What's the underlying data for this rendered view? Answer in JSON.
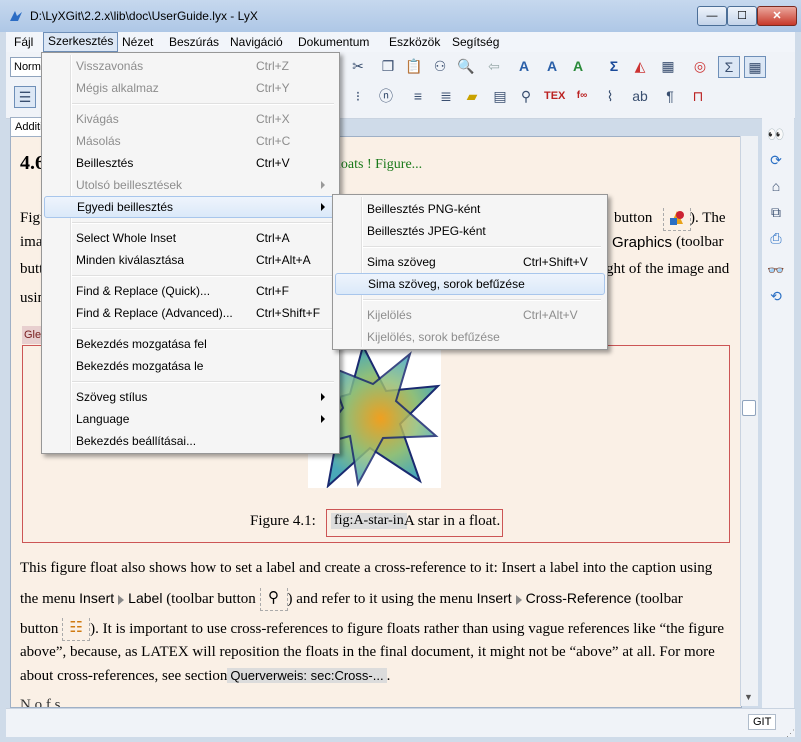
{
  "window": {
    "title": "D:\\LyXGit\\2.2.x\\lib\\doc\\UserGuide.lyx - LyX",
    "minimize_glyph": "—",
    "maximize_glyph": "☐",
    "close_glyph": "✕"
  },
  "menubar": {
    "items": [
      "Fájl",
      "Szerkesztés",
      "Nézet",
      "Beszúrás",
      "Navigáció",
      "Dokumentum",
      "Eszközök",
      "Segítség"
    ],
    "active": "Szerkesztés"
  },
  "toolbar": {
    "layout_combo_value": "Normál",
    "tab_label": "Additional"
  },
  "edit_menu": {
    "items": [
      {
        "label": "Visszavonás",
        "shortcut": "Ctrl+Z",
        "disabled": true
      },
      {
        "label": "Mégis alkalmaz",
        "shortcut": "Ctrl+Y",
        "disabled": true
      },
      {
        "label": "Kivágás",
        "shortcut": "Ctrl+X",
        "disabled": true
      },
      {
        "label": "Másolás",
        "shortcut": "Ctrl+C",
        "disabled": true
      },
      {
        "label": "Beillesztés",
        "shortcut": "Ctrl+V",
        "disabled": false
      },
      {
        "label": "Utolsó beillesztések",
        "shortcut": "",
        "disabled": true,
        "submenu": true
      },
      {
        "label": "Egyedi beillesztés",
        "shortcut": "",
        "disabled": false,
        "submenu": true,
        "highlight": true
      },
      {
        "label": "Select Whole Inset",
        "shortcut": "Ctrl+A",
        "disabled": false
      },
      {
        "label": "Minden kiválasztása",
        "shortcut": "Ctrl+Alt+A",
        "disabled": false
      },
      {
        "label": "Find & Replace (Quick)...",
        "shortcut": "Ctrl+F",
        "disabled": false
      },
      {
        "label": "Find & Replace (Advanced)...",
        "shortcut": "Ctrl+Shift+F",
        "disabled": false
      },
      {
        "label": "Bekezdés mozgatása fel",
        "shortcut": "",
        "disabled": false
      },
      {
        "label": "Bekezdés mozgatása le",
        "shortcut": "",
        "disabled": false
      },
      {
        "label": "Szöveg stílus",
        "shortcut": "",
        "disabled": false,
        "submenu": true
      },
      {
        "label": "Language",
        "shortcut": "",
        "disabled": false,
        "submenu": true
      },
      {
        "label": "Bekezdés beállításai...",
        "shortcut": "",
        "disabled": false
      }
    ]
  },
  "paste_submenu": {
    "items": [
      {
        "label": "Beillesztés PNG-ként",
        "shortcut": "",
        "disabled": false
      },
      {
        "label": "Beillesztés JPEG-ként",
        "shortcut": "",
        "disabled": false
      },
      {
        "label": "Sima szöveg",
        "shortcut": "Ctrl+Shift+V",
        "disabled": false
      },
      {
        "label": "Sima szöveg, sorok befűzése",
        "shortcut": "",
        "disabled": false,
        "highlight": true
      },
      {
        "label": "Kijelölés",
        "shortcut": "Ctrl+Alt+V",
        "disabled": true
      },
      {
        "label": "Kijelölés, sorok befűzése",
        "shortcut": "",
        "disabled": true
      }
    ]
  },
  "document": {
    "heading_number": "4.6",
    "float_label": "loats ! Figure...",
    "para1": {
      "line1_start": "Figu",
      "line1_end": "button",
      "line1_after": "). The",
      "line2_start": "ima",
      "line2_end_ui": "Graphics",
      "line2_end": " (toolbar",
      "line3_start": "butt",
      "line3_end": "ght of the image and",
      "line4_start": "usin"
    },
    "float_tag": "Glei",
    "caption": {
      "prefix": "Figure 4.1:",
      "label": "fig:A-star-in",
      "text": "A star in a float."
    },
    "para2": {
      "line1": "This figure float also shows how to set a label and create a cross-reference to it: Insert a label into the caption using",
      "line2_a": "the menu",
      "line2_insert": "Insert",
      "line2_label": "Label",
      "line2_b": " (toolbar button",
      "line2_c": ") and refer to it using the menu",
      "line2_insert2": "Insert",
      "line2_crossref": "Cross-Reference",
      "line2_d": " (toolbar",
      "line3_a": "button",
      "line3_b": "). It is important to use cross-references to figure floats rather than using vague references like “the figure",
      "line4": "above”, because, as LATEX will reposition the floats in the final document, it might not be “above” at all. For more",
      "line5_a": "about cross-references, see section",
      "line5_ref": "Querverweis: sec:Cross-...",
      "line5_b": ".",
      "line6": "N                                                                  o     f      s"
    }
  },
  "statusbar": {
    "git": "GIT"
  },
  "colors": {
    "doc_bg": "#faf0e6",
    "float_border": "#cc5555",
    "float_label_green": "#1a7a1a",
    "menu_highlight": "#dbe9f9"
  }
}
